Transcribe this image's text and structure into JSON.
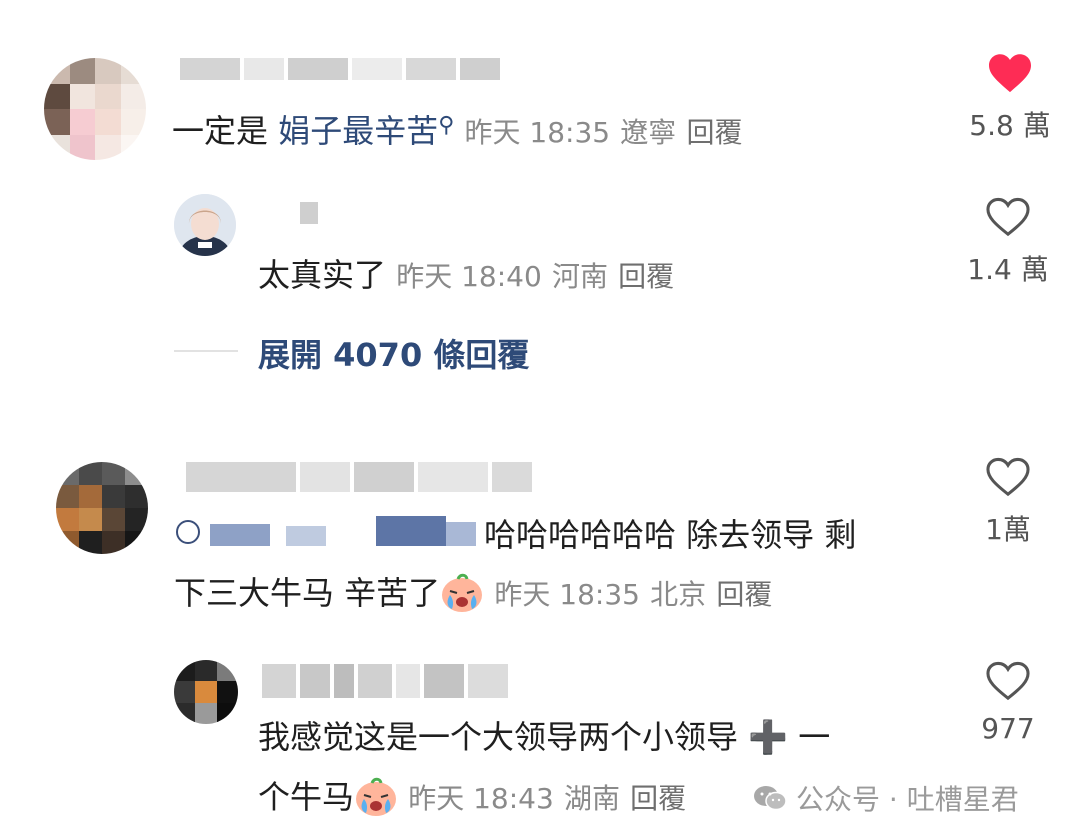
{
  "comments": [
    {
      "text_prefix": "一定是 ",
      "tag": "娟子最辛苦",
      "search_glyph": "⚲",
      "time": "昨天 18:35",
      "location": "遼寧",
      "reply": "回覆",
      "likes": "5.8 萬",
      "liked": true
    },
    {
      "text": "太真实了",
      "time": "昨天 18:40",
      "location": "河南",
      "reply": "回覆",
      "likes": "1.4 萬",
      "liked": false
    },
    {
      "line1": "哈哈哈哈哈哈 除去领导 剩",
      "line2": "下三大牛马 辛苦了",
      "time": "昨天 18:35",
      "location": "北京",
      "reply": "回覆",
      "likes": "1萬",
      "liked": false
    },
    {
      "line1": "我感觉这是一个大领导两个小领导 ➕ 一",
      "line2": "个牛马",
      "time": "昨天 18:43",
      "location": "湖南",
      "reply": "回覆",
      "likes": "977",
      "liked": false
    }
  ],
  "expand_replies": "展開 4070 條回覆",
  "watermark": "公众号 · 吐槽星君",
  "colors": {
    "like_active": "#fe2c55",
    "tag": "#2e4a78",
    "meta": "#8a8a8a"
  }
}
